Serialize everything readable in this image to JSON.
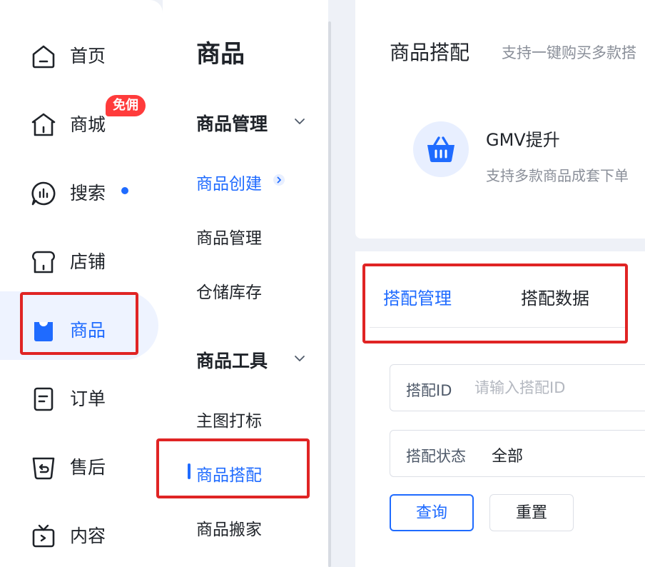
{
  "nav": {
    "items": [
      {
        "label": "首页",
        "icon": "home-icon"
      },
      {
        "label": "商城",
        "icon": "mall-icon",
        "badge": "免佣"
      },
      {
        "label": "搜索",
        "icon": "search-icon",
        "dot": true
      },
      {
        "label": "店铺",
        "icon": "store-icon"
      },
      {
        "label": "商品",
        "icon": "product-bag-icon",
        "active": true
      },
      {
        "label": "订单",
        "icon": "order-icon"
      },
      {
        "label": "售后",
        "icon": "after-sales-icon"
      },
      {
        "label": "内容",
        "icon": "content-tv-icon"
      }
    ]
  },
  "subnav": {
    "title": "商品",
    "groups": [
      {
        "label": "商品管理",
        "items": [
          "商品创建",
          "商品管理",
          "仓储库存"
        ]
      },
      {
        "label": "商品工具",
        "items": [
          "主图打标",
          "商品搭配",
          "商品搬家"
        ]
      }
    ],
    "active_item": "商品搭配"
  },
  "main": {
    "page_title": "商品搭配",
    "page_subtitle": "支持一键购买多款搭",
    "feature": {
      "title": "GMV提升",
      "desc": "支持多款商品成套下单",
      "icon": "basket-icon"
    },
    "tabs": [
      {
        "label": "搭配管理",
        "active": true
      },
      {
        "label": "搭配数据",
        "active": false
      }
    ],
    "filters": {
      "id_label": "搭配ID",
      "id_placeholder": "请输入搭配ID",
      "status_label": "搭配状态",
      "status_value": "全部"
    },
    "buttons": {
      "query": "查询",
      "reset": "重置"
    }
  },
  "colors": {
    "accent": "#1f6bff",
    "highlight": "#e02424",
    "badge": "#ff3b3b"
  }
}
